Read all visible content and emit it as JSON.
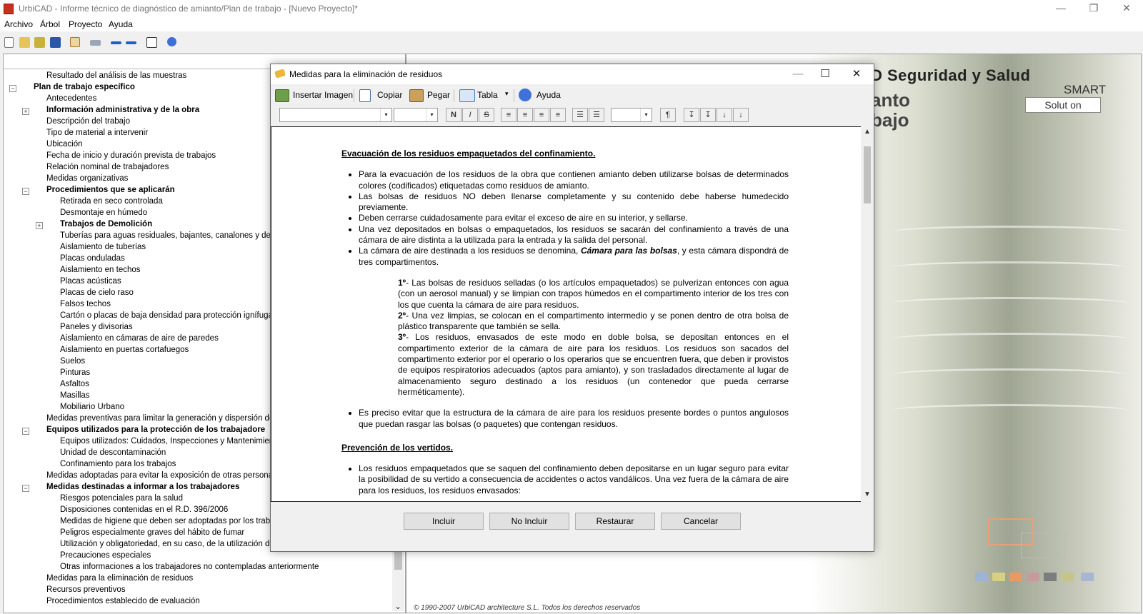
{
  "app": {
    "title": "UrbiCAD - Informe técnico de diagnóstico de amianto/Plan de trabajo  - [Nuevo Proyecto]*",
    "window_controls": {
      "minimize": "—",
      "restore": "❐",
      "close": "✕"
    }
  },
  "menu": [
    "Archivo",
    "Árbol",
    "Proyecto",
    "Ayuda"
  ],
  "toolbar_icons": [
    "new-file-icon",
    "open-icon",
    "open-folder-icon",
    "save-icon",
    "copy-icon",
    "link-icon",
    "add-icon",
    "remove-icon",
    "export-icon",
    "help-icon"
  ],
  "tree": [
    {
      "label": "Resultado del análisis de las muestras",
      "bold": false,
      "level": 2,
      "exp": ""
    },
    {
      "label": "Plan de trabajo específico",
      "bold": true,
      "level": 1,
      "exp": "−"
    },
    {
      "label": "Antecedentes",
      "bold": false,
      "level": 2,
      "exp": ""
    },
    {
      "label": "Información administrativa y de la obra",
      "bold": true,
      "level": 2,
      "exp": "+"
    },
    {
      "label": "Descripción del trabajo",
      "bold": false,
      "level": 2,
      "exp": ""
    },
    {
      "label": "Tipo de material a intervenir",
      "bold": false,
      "level": 2,
      "exp": ""
    },
    {
      "label": "Ubicación",
      "bold": false,
      "level": 2,
      "exp": ""
    },
    {
      "label": "Fecha de inicio y duración prevista de trabajos",
      "bold": false,
      "level": 2,
      "exp": ""
    },
    {
      "label": "Relación nominal de trabajadores",
      "bold": false,
      "level": 2,
      "exp": ""
    },
    {
      "label": "Medidas organizativas",
      "bold": false,
      "level": 2,
      "exp": ""
    },
    {
      "label": "Procedimientos que se aplicarán",
      "bold": true,
      "level": 2,
      "exp": "−"
    },
    {
      "label": "Retirada en seco controlada",
      "bold": false,
      "level": 3,
      "exp": ""
    },
    {
      "label": "Desmontaje en húmedo",
      "bold": false,
      "level": 3,
      "exp": ""
    },
    {
      "label": "Trabajos de Demolición",
      "bold": true,
      "level": 3,
      "exp": "+"
    },
    {
      "label": "Tuberías para aguas residuales, bajantes, canalones y depósit",
      "bold": false,
      "level": 3,
      "exp": ""
    },
    {
      "label": "Aislamiento de tuberías",
      "bold": false,
      "level": 3,
      "exp": ""
    },
    {
      "label": "Placas onduladas",
      "bold": false,
      "level": 3,
      "exp": ""
    },
    {
      "label": "Aislamiento en techos",
      "bold": false,
      "level": 3,
      "exp": ""
    },
    {
      "label": "Placas acústicas",
      "bold": false,
      "level": 3,
      "exp": ""
    },
    {
      "label": "Placas de cielo raso",
      "bold": false,
      "level": 3,
      "exp": ""
    },
    {
      "label": "Falsos techos",
      "bold": false,
      "level": 3,
      "exp": ""
    },
    {
      "label": "Cartón o placas de baja densidad para protección ignífuga",
      "bold": false,
      "level": 3,
      "exp": ""
    },
    {
      "label": "Paneles y divisorias",
      "bold": false,
      "level": 3,
      "exp": ""
    },
    {
      "label": "Aislamiento en cámaras de aire de paredes",
      "bold": false,
      "level": 3,
      "exp": ""
    },
    {
      "label": "Aislamiento en puertas cortafuegos",
      "bold": false,
      "level": 3,
      "exp": ""
    },
    {
      "label": "Suelos",
      "bold": false,
      "level": 3,
      "exp": ""
    },
    {
      "label": "Pinturas",
      "bold": false,
      "level": 3,
      "exp": ""
    },
    {
      "label": "Asfaltos",
      "bold": false,
      "level": 3,
      "exp": ""
    },
    {
      "label": "Masillas",
      "bold": false,
      "level": 3,
      "exp": ""
    },
    {
      "label": "Mobiliario Urbano",
      "bold": false,
      "level": 3,
      "exp": ""
    },
    {
      "label": "Medidas preventivas para limitar la generación y dispersión de fibra",
      "bold": false,
      "level": 2,
      "exp": ""
    },
    {
      "label": "Equipos utilizados para la protección de los trabajadore",
      "bold": true,
      "level": 2,
      "exp": "−"
    },
    {
      "label": "Equipos utilizados: Cuidados, Inspecciones y Mantenimientos",
      "bold": false,
      "level": 3,
      "exp": ""
    },
    {
      "label": "Unidad de descontaminación",
      "bold": false,
      "level": 3,
      "exp": ""
    },
    {
      "label": "Confinamiento para los trabajos",
      "bold": false,
      "level": 3,
      "exp": ""
    },
    {
      "label": "Medidas adoptadas para evitar la exposición de otras personas",
      "bold": false,
      "level": 2,
      "exp": ""
    },
    {
      "label": "Medidas destinadas a informar a los trabajadores",
      "bold": true,
      "level": 2,
      "exp": "−"
    },
    {
      "label": "Riesgos potenciales para la salud",
      "bold": false,
      "level": 3,
      "exp": ""
    },
    {
      "label": "Disposiciones contenidas en el R.D. 396/2006",
      "bold": false,
      "level": 3,
      "exp": ""
    },
    {
      "label": "Medidas de higiene que deben ser adoptadas por los trabajad",
      "bold": false,
      "level": 3,
      "exp": ""
    },
    {
      "label": "Peligros especialmente graves del hábito de fumar",
      "bold": false,
      "level": 3,
      "exp": ""
    },
    {
      "label": "Utilización y obligatoriedad, en su caso, de la utilización de los EPIS",
      "bold": false,
      "level": 3,
      "exp": ""
    },
    {
      "label": "Precauciones especiales",
      "bold": false,
      "level": 3,
      "exp": ""
    },
    {
      "label": "Otras informaciones a los trabajadores no contempladas anteriormente",
      "bold": false,
      "level": 3,
      "exp": ""
    },
    {
      "label": "Medidas para la eliminación de residuos",
      "bold": false,
      "level": 2,
      "exp": ""
    },
    {
      "label": "Recursos preventivos",
      "bold": false,
      "level": 2,
      "exp": ""
    },
    {
      "label": "Procedimientos establecido de evaluación",
      "bold": false,
      "level": 2,
      "exp": ""
    }
  ],
  "tree_scroll_arrow": "⌄",
  "preview": {
    "brand_line1": "D Seguridad y Salud",
    "brand_line2a": "anto",
    "brand_line2b": "bajo",
    "smart": "SMART",
    "solution": "Solut on",
    "copyright": "© 1990-2007 UrbiCAD architecture S.L. Todos los derechos reservados"
  },
  "dialog": {
    "title": "Medidas para la eliminación de residuos",
    "controls": {
      "minimize": "—",
      "maximize": "☐",
      "close": "✕"
    },
    "toolbar": {
      "insert_image": "Insertar Imagen",
      "copy": "Copiar",
      "paste": "Pegar",
      "table": "Tabla",
      "help": "Ayuda",
      "table_arrow": "▾"
    },
    "format": {
      "bold": "N",
      "italic": "I",
      "strike": "S",
      "para": "¶",
      "combo_arrow": "▾",
      "buttons": [
        "≡",
        "≡",
        "≡",
        "≡",
        "☰",
        "☰",
        "↧",
        "↧",
        "↓",
        "↓"
      ]
    },
    "content": {
      "h1": "Evacuación de los residuos empaquetados del confinamiento.",
      "b1": "Para la evacuación de los residuos de la obra que contienen amianto deben utilizarse bolsas de determinados colores (codificados) etiquetadas como residuos de amianto.",
      "b2": "Las bolsas de residuos NO deben llenarse completamente y su contenido debe haberse humedecido previamente.",
      "b3": "Deben cerrarse cuidadosamente para evitar el exceso de aire en su interior, y sellarse.",
      "b4": "Una vez depositados en bolsas o empaquetados, los residuos se sacarán del confinamiento a través de una cámara de aire distinta a la utilizada para la entrada y la salida del personal.",
      "b5_pre": "La cámara de aire destinada a los residuos se denomina, ",
      "b5_em": "Cámara para las bolsas",
      "b5_post": ", y esta cámara dispondrá de tres compartimentos.",
      "s1_n": "1º",
      "s1": "- Las bolsas de residuos selladas (o los artículos empaquetados) se pulverizan entonces con agua (con un aerosol manual) y se limpian con trapos húmedos en el compartimento interior de los tres con los que cuenta la cámara de aire para residuos.",
      "s2_n": "2º",
      "s2": "- Una vez limpias, se colocan en el compartimento intermedio y se ponen dentro de otra bolsa de plástico transparente que también se sella.",
      "s3_n": "3º",
      "s3": "- Los residuos, envasados de este modo en doble bolsa, se depositan entonces en el compartimento exterior de la cámara de aire para los residuos. Los residuos son sacados del compartimento exterior por el operario o los operarios que se encuentren fuera, que deben ir provistos de equipos respiratorios adecuados (aptos para amianto), y son trasladados directamente al lugar de almacenamiento seguro destinado a los residuos (un contenedor que pueda cerrarse herméticamente).",
      "b6": "Es preciso evitar que la estructura de la cámara de aire para los residuos presente bordes o puntos angulosos que puedan rasgar las bolsas (o paquetes) que contengan residuos.",
      "h2": "Prevención de los vertidos.",
      "b7": "Los residuos empaquetados que se saquen del confinamiento deben depositarse en un lugar seguro para evitar la posibilidad de su vertido a consecuencia de accidentes o actos vandálicos. Una vez fuera de la cámara de aire para los residuos, los residuos envasados:"
    },
    "scroll": {
      "up": "▲",
      "down": "▼"
    },
    "buttons": {
      "include": "Incluir",
      "not_include": "No Incluir",
      "restore": "Restaurar",
      "cancel": "Cancelar"
    }
  },
  "colors": {
    "accent": "#0078d7",
    "app_icon": "#c8301e"
  }
}
